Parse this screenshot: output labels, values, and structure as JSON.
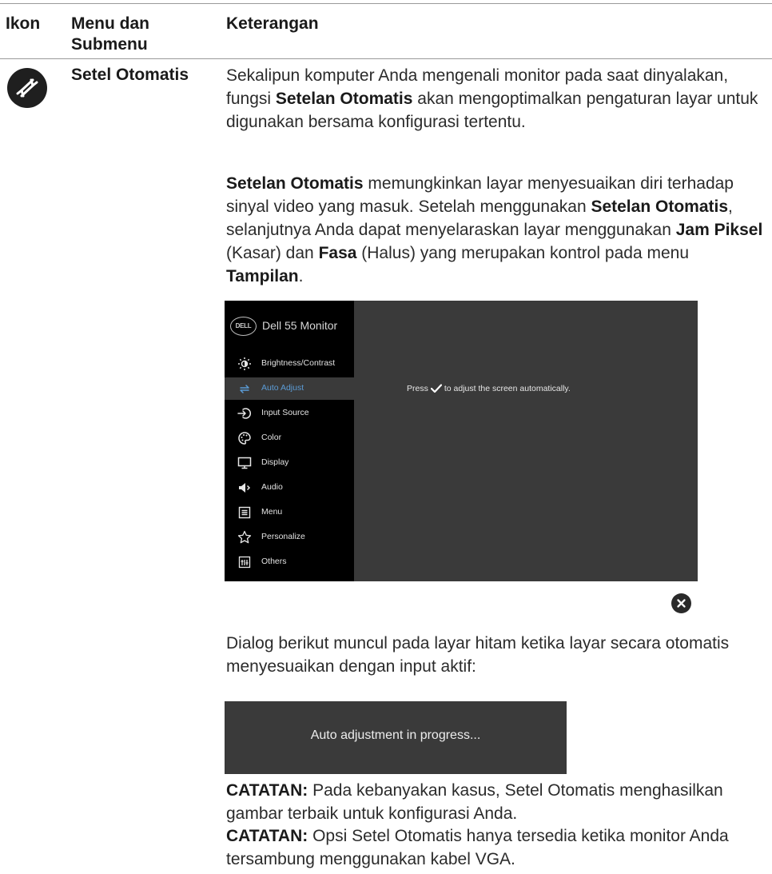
{
  "table": {
    "headers": {
      "icon": "Ikon",
      "menu": "Menu dan Submenu",
      "desc": "Keterangan"
    },
    "row": {
      "icon": "auto-adjust-icon",
      "menu": "Setel Otomatis",
      "p1": {
        "pre": "Sekalipun komputer Anda mengenali monitor pada saat dinyalakan, fungsi ",
        "b1": "Setelan Otomatis",
        "post": " akan  mengoptimalkan pengaturan layar untuk digunakan bersama konfigurasi tertentu."
      },
      "p2": {
        "b1": "Setelan Otomatis",
        "t1": " memungkinkan layar menyesuaikan diri terhadap sinyal  video yang masuk. Setelah menggunakan ",
        "b2": "Setelan Otomatis",
        "t2": ", selanjutnya Anda dapat menyelaraskan layar menggunakan ",
        "b3": "Jam Piksel",
        "t3": " (Kasar) dan ",
        "b4": "Fasa",
        "t4": " (Halus) yang merupakan kontrol pada menu ",
        "b5": "Tampilan",
        "t5": "."
      },
      "p3": "Dialog berikut muncul pada layar hitam ketika layar secara otomatis menyesuaikan dengan input aktif:",
      "note1": {
        "label": "CATATAN:",
        "text": " Pada kebanyakan kasus, Setel Otomatis menghasilkan gambar terbaik untuk konfigurasi Anda."
      },
      "note2": {
        "label": "CATATAN:",
        "text": " Opsi Setel Otomatis hanya tersedia ketika monitor Anda tersambung menggunakan kabel VGA."
      }
    }
  },
  "osd": {
    "logo": "DELL",
    "title": "Dell 55 Monitor",
    "items": [
      {
        "label": "Brightness/Contrast",
        "icon": "brightness-icon"
      },
      {
        "label": "Auto Adjust",
        "icon": "auto-adjust-icon",
        "active": true
      },
      {
        "label": "Input Source",
        "icon": "input-source-icon"
      },
      {
        "label": "Color",
        "icon": "color-palette-icon"
      },
      {
        "label": "Display",
        "icon": "display-icon"
      },
      {
        "label": "Audio",
        "icon": "speaker-icon"
      },
      {
        "label": "Menu",
        "icon": "menu-icon"
      },
      {
        "label": "Personalize",
        "icon": "star-icon"
      },
      {
        "label": "Others",
        "icon": "others-icon"
      }
    ],
    "message": {
      "pre": "Press",
      "post": "to adjust the screen automatically."
    },
    "accent": "#5b9bd5"
  },
  "progress_dialog": {
    "text": "Auto adjustment in progress..."
  }
}
